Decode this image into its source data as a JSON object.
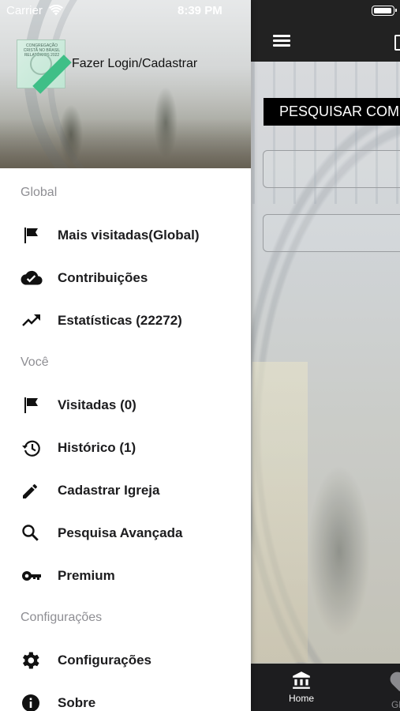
{
  "status_bar": {
    "carrier": "Carrier",
    "time": "8:39 PM"
  },
  "drawer": {
    "login_label": "Fazer Login/Cadastrar",
    "logo_text": "CONGREGAÇÃO CRISTÃ NO BRASIL RELATÓRIOS 2022",
    "sections": [
      {
        "title": "Global",
        "items": [
          {
            "icon": "flag-icon",
            "label": "Mais visitadas(Global)"
          },
          {
            "icon": "cloud-done-icon",
            "label": "Contribuições"
          },
          {
            "icon": "trending-up-icon",
            "label": "Estatísticas (22272)"
          }
        ]
      },
      {
        "title": "Você",
        "items": [
          {
            "icon": "flag-icon",
            "label": "Visitadas (0)"
          },
          {
            "icon": "history-icon",
            "label": "Histórico (1)"
          },
          {
            "icon": "pencil-icon",
            "label": "Cadastrar Igreja"
          },
          {
            "icon": "search-icon",
            "label": "Pesquisa Avançada"
          },
          {
            "icon": "key-icon",
            "label": "Premium"
          }
        ]
      },
      {
        "title": "Configurações",
        "items": [
          {
            "icon": "gear-icon",
            "label": "Configurações"
          },
          {
            "icon": "info-icon",
            "label": "Sobre"
          }
        ]
      }
    ]
  },
  "main": {
    "search_button_label": "PESQUISAR COMUNIDADES",
    "tabs": [
      {
        "label": "Home"
      },
      {
        "label": "Gl"
      }
    ]
  }
}
